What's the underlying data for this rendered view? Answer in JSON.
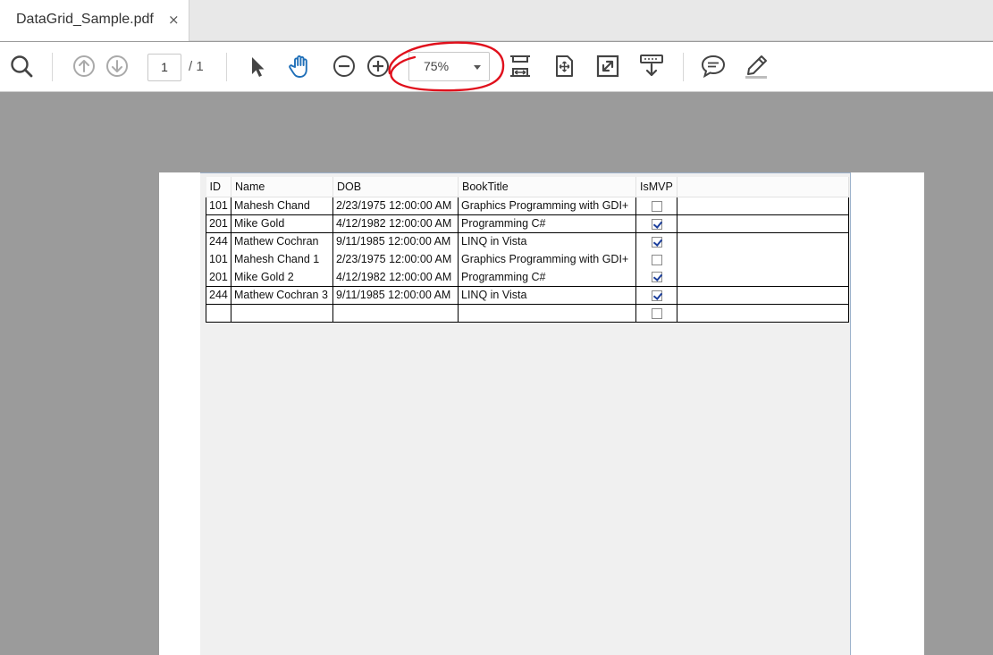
{
  "tab": {
    "title": "DataGrid_Sample.pdf",
    "close": "×"
  },
  "toolbar": {
    "current_page": "1",
    "page_total": "/ 1",
    "zoom": "75%",
    "tools": [
      "search-icon",
      "page-up-icon",
      "page-down-icon",
      "select-arrow-icon",
      "hand-tool-icon",
      "zoom-out-icon",
      "zoom-in-icon",
      "fit-width-icon",
      "fit-page-icon",
      "fullscreen-icon",
      "read-mode-icon",
      "comment-icon",
      "highlight-pen-icon"
    ],
    "accent": "#1f6fb8",
    "annotation_color": "#e0101c"
  },
  "grid": {
    "columns": [
      "ID",
      "Name",
      "DOB",
      "BookTitle",
      "IsMVP"
    ],
    "rows": [
      {
        "id": "101",
        "name": "Mahesh Chand",
        "dob": "2/23/1975 12:00:00 AM",
        "book": "Graphics Programming with GDI+",
        "mvp": false
      },
      {
        "id": "201",
        "name": "Mike Gold",
        "dob": "4/12/1982 12:00:00 AM",
        "book": "Programming C#",
        "mvp": true
      },
      {
        "id": "244",
        "name": "Mathew Cochran",
        "dob": "9/11/1985 12:00:00 AM",
        "book": "LINQ in Vista",
        "mvp": true
      },
      {
        "id": "101",
        "name": "Mahesh Chand 1",
        "dob": "2/23/1975 12:00:00 AM",
        "book": "Graphics Programming with GDI+",
        "mvp": false
      },
      {
        "id": "201",
        "name": "Mike Gold 2",
        "dob": "4/12/1982 12:00:00 AM",
        "book": "Programming C#",
        "mvp": true
      },
      {
        "id": "244",
        "name": "Mathew Cochran 3",
        "dob": "9/11/1985 12:00:00 AM",
        "book": "LINQ in Vista",
        "mvp": true
      },
      {
        "id": "",
        "name": "",
        "dob": "",
        "book": "",
        "mvp": false
      }
    ]
  }
}
